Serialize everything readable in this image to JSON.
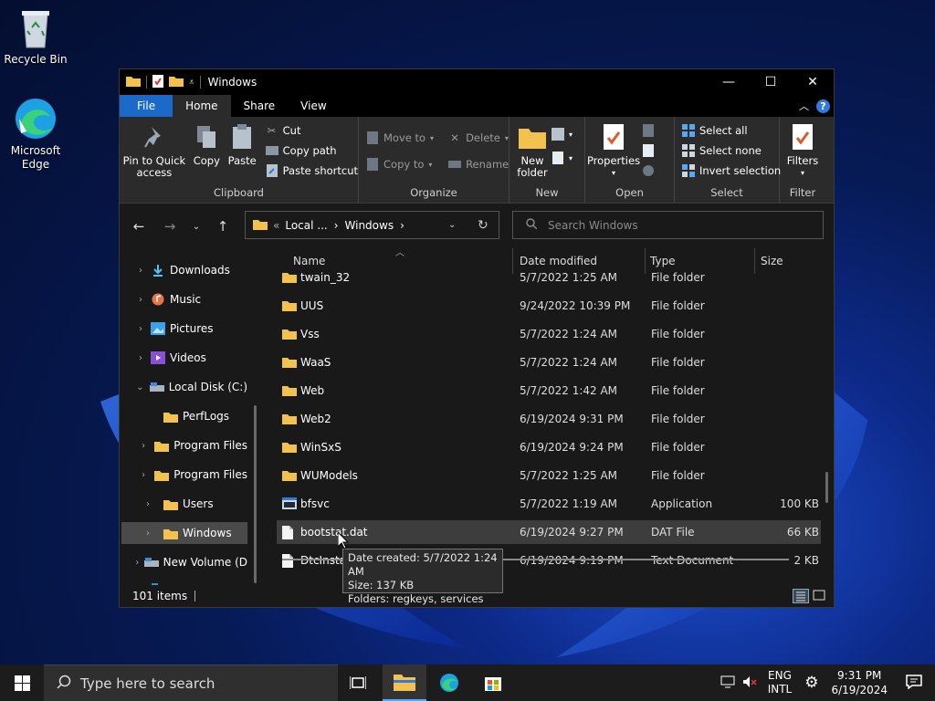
{
  "desktop": {
    "recycle_bin": "Recycle Bin",
    "edge": "Microsoft Edge"
  },
  "window": {
    "title": "Windows",
    "tabs": [
      "File",
      "Home",
      "Share",
      "View"
    ],
    "active_tab": "Home"
  },
  "ribbon": {
    "clipboard": {
      "pin": "Pin to Quick access",
      "copy": "Copy",
      "paste": "Paste",
      "cut": "Cut",
      "copy_path": "Copy path",
      "paste_shortcut": "Paste shortcut",
      "label": "Clipboard"
    },
    "organize": {
      "move_to": "Move to",
      "copy_to": "Copy to",
      "delete": "Delete",
      "rename": "Rename",
      "label": "Organize"
    },
    "new": {
      "new_folder": "New folder",
      "label": "New"
    },
    "open": {
      "properties": "Properties",
      "label": "Open"
    },
    "select": {
      "select_all": "Select all",
      "select_none": "Select none",
      "invert": "Invert selection",
      "label": "Select"
    },
    "filter": {
      "filters": "Filters",
      "label": "Filter"
    }
  },
  "address": {
    "crumb1": "Local ...",
    "crumb2": "Windows",
    "search_placeholder": "Search Windows"
  },
  "nav_pane": [
    {
      "label": "Downloads",
      "icon": "download-icon"
    },
    {
      "label": "Music",
      "icon": "music-icon"
    },
    {
      "label": "Pictures",
      "icon": "pictures-icon"
    },
    {
      "label": "Videos",
      "icon": "videos-icon"
    },
    {
      "label": "Local Disk (C:)",
      "icon": "drive-icon"
    },
    {
      "label": "PerfLogs",
      "icon": "folder-icon"
    },
    {
      "label": "Program Files",
      "icon": "folder-icon"
    },
    {
      "label": "Program Files",
      "icon": "folder-icon"
    },
    {
      "label": "Users",
      "icon": "folder-icon"
    },
    {
      "label": "Windows",
      "icon": "folder-icon"
    },
    {
      "label": "New Volume (D",
      "icon": "drive-icon"
    }
  ],
  "columns": {
    "name": "Name",
    "date": "Date modified",
    "type": "Type",
    "size": "Size"
  },
  "files": [
    {
      "name": "twain_32",
      "date": "5/7/2022 1:25 AM",
      "type": "File folder",
      "size": "",
      "kind": "folder"
    },
    {
      "name": "UUS",
      "date": "9/24/2022 10:39 PM",
      "type": "File folder",
      "size": "",
      "kind": "folder"
    },
    {
      "name": "Vss",
      "date": "5/7/2022 1:24 AM",
      "type": "File folder",
      "size": "",
      "kind": "folder"
    },
    {
      "name": "WaaS",
      "date": "5/7/2022 1:24 AM",
      "type": "File folder",
      "size": "",
      "kind": "folder"
    },
    {
      "name": "Web",
      "date": "5/7/2022 1:42 AM",
      "type": "File folder",
      "size": "",
      "kind": "folder"
    },
    {
      "name": "Web2",
      "date": "6/19/2024 9:31 PM",
      "type": "File folder",
      "size": "",
      "kind": "folder"
    },
    {
      "name": "WinSxS",
      "date": "6/19/2024 9:24 PM",
      "type": "File folder",
      "size": "",
      "kind": "folder"
    },
    {
      "name": "WUModels",
      "date": "5/7/2022 1:25 AM",
      "type": "File folder",
      "size": "",
      "kind": "folder"
    },
    {
      "name": "bfsvc",
      "date": "5/7/2022 1:19 AM",
      "type": "Application",
      "size": "100 KB",
      "kind": "app"
    },
    {
      "name": "bootstat.dat",
      "date": "6/19/2024 9:27 PM",
      "type": "DAT File",
      "size": "66 KB",
      "kind": "file"
    },
    {
      "name": "DtcInstall",
      "date": "6/19/2024 9:19 PM",
      "type": "Text Document",
      "size": "2 KB",
      "kind": "file"
    }
  ],
  "status": {
    "items": "101 items"
  },
  "tooltip": {
    "line1": "Date created: 5/7/2022 1:24 AM",
    "line2": "Size: 137 KB",
    "line3": "Folders: regkeys, services"
  },
  "taskbar": {
    "search_placeholder": "Type here to search",
    "lang1": "ENG",
    "lang2": "INTL",
    "time": "9:31 PM",
    "date": "6/19/2024"
  },
  "colors": {
    "accent": "#1b6ac9",
    "folder": "#f2c14e",
    "window_bg": "#191919",
    "ribbon_bg": "#2b2b2b"
  }
}
